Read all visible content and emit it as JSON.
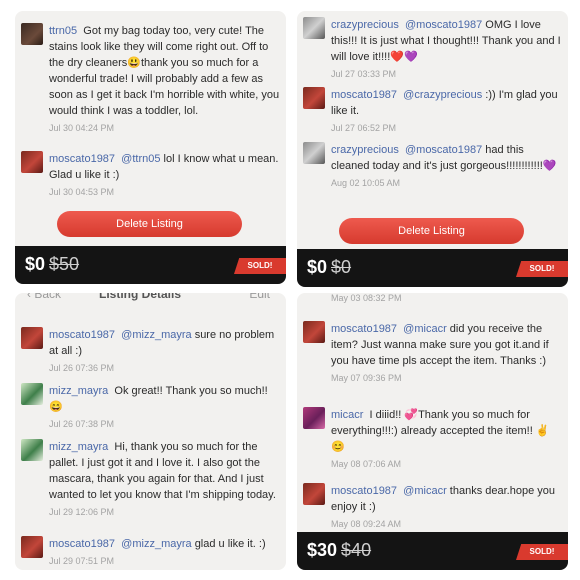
{
  "panel1": {
    "comments": [
      {
        "user": "ttrn05",
        "text": "Got my bag today too, very cute! The stains look like they will come right out. Off to the dry cleaners",
        "emoji": "😃",
        "text2": "thank you so much for a wonderful trade! I will probably add a few as soon as I get it back I'm horrible with white, you would think I was a toddler, lol.",
        "time": "Jul 30 04:24 PM"
      },
      {
        "user": "moscato1987",
        "mention": "@ttrn05",
        "text": "lol I know what u mean. Glad u like it :)",
        "time": "Jul 30 04:53 PM"
      }
    ],
    "button_label": "Delete Listing",
    "price": "$0",
    "original_price": "$50",
    "badge": "SOLD!"
  },
  "panel2": {
    "comments": [
      {
        "user": "crazyprecious",
        "mention": "@moscato1987",
        "text": "OMG I love this!!! It is just what I thought!!! Thank you and I will love it!!!!",
        "emoji": "❤️💜",
        "time": "Jul 27 03:33 PM"
      },
      {
        "user": "moscato1987",
        "mention": "@crazyprecious",
        "text": ":)) I'm glad you like it.",
        "time": "Jul 27 06:52 PM"
      },
      {
        "user": "crazyprecious",
        "mention": "@moscato1987",
        "text": "had this cleaned today and it's just gorgeous!!!!!!!!!!!!",
        "emoji": "💜",
        "time": "Aug 02 10:05 AM"
      }
    ],
    "button_label": "Delete Listing",
    "price": "$0",
    "original_price": "$0",
    "badge": "SOLD!"
  },
  "panel3": {
    "nav": {
      "back": "Back",
      "title": "Listing Details",
      "edit": "Edit"
    },
    "comments": [
      {
        "user": "moscato1987",
        "mention": "@mizz_mayra",
        "text": "sure no problem at all :)",
        "time": "Jul 26 07:36 PM"
      },
      {
        "user": "mizz_mayra",
        "text": "Ok great!! Thank you so much!!",
        "emoji": "😄",
        "time": "Jul 26 07:38 PM"
      },
      {
        "user": "mizz_mayra",
        "text": "Hi, thank you so much for the pallet. I just got it and I love it. I also got the mascara, thank you again for that. And I just wanted to let you know that I'm shipping today.",
        "time": "Jul 29 12:06 PM"
      },
      {
        "user": "moscato1987",
        "mention": "@mizz_mayra",
        "text": "glad u like it. :)",
        "time": "Jul 29 07:51 PM"
      }
    ]
  },
  "panel4": {
    "top_time": "May 03 08:32 PM",
    "comments": [
      {
        "user": "moscato1987",
        "mention": "@micacr",
        "text": "did you receive the item? Just wanna make sure you got it.and if you have time pls accept the item. Thanks :)",
        "time": "May 07 09:36 PM"
      },
      {
        "user": "micacr",
        "text": "I diiid!!",
        "emoji": "💞",
        "text2": "Thank you so much for everything!!!:) already accepted the item!!",
        "emoji2": "✌️😊",
        "time": "May 08 07:06 AM"
      },
      {
        "user": "moscato1987",
        "mention": "@micacr",
        "text": "thanks dear.hope you enjoy it :)",
        "time": "May 08 09:24 AM"
      }
    ],
    "price": "$30",
    "original_price": "$40",
    "badge": "SOLD!"
  }
}
